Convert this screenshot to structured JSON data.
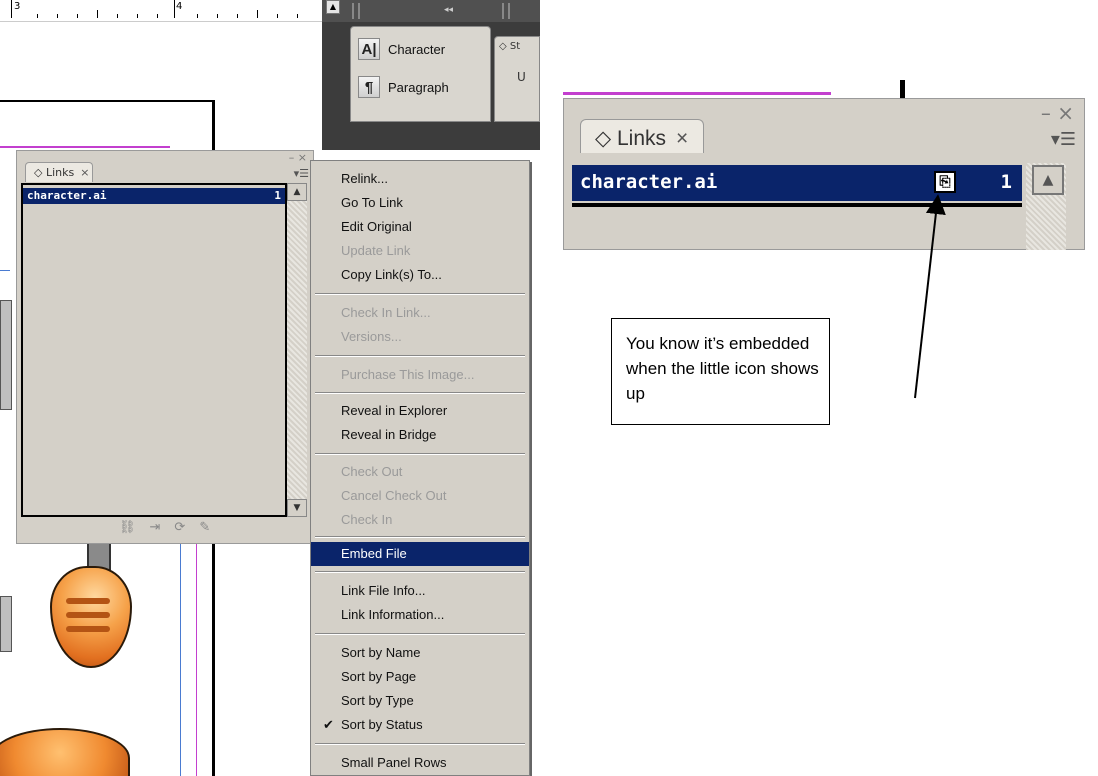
{
  "left_capture": {
    "ruler": {
      "mark_3": "3",
      "mark_4": "4"
    },
    "panel_dock": {
      "collapse_label": "◂◂",
      "items": [
        {
          "icon": "character-panel-icon",
          "glyph": "A|",
          "label": "Character"
        },
        {
          "icon": "paragraph-panel-icon",
          "glyph": "¶",
          "label": "Paragraph"
        }
      ],
      "partial_tab": "◇ St",
      "partial_tab_sub": "U"
    },
    "links_panel": {
      "tab_label": "◇ Links",
      "close_glyph": "×",
      "window_controls": "– ×",
      "menu_glyph": "▾☰",
      "rows": [
        {
          "name": "character.ai",
          "page": "1"
        }
      ]
    },
    "context_menu": {
      "items": [
        {
          "label": "Relink...",
          "disabled": false
        },
        {
          "label": "Go To Link",
          "disabled": false
        },
        {
          "label": "Edit Original",
          "disabled": false
        },
        {
          "label": "Update Link",
          "disabled": true
        },
        {
          "label": "Copy Link(s) To...",
          "disabled": false
        },
        {
          "label": "Check In Link...",
          "disabled": true
        },
        {
          "label": "Versions...",
          "disabled": true
        },
        {
          "label": "Purchase This Image...",
          "disabled": true
        },
        {
          "label": "Reveal in Explorer",
          "disabled": false
        },
        {
          "label": "Reveal in Bridge",
          "disabled": false
        },
        {
          "label": "Check Out",
          "disabled": true
        },
        {
          "label": "Cancel Check Out",
          "disabled": true
        },
        {
          "label": "Check In",
          "disabled": true
        },
        {
          "label": "Embed File",
          "disabled": false,
          "highlighted": true
        },
        {
          "label": "Link File Info...",
          "disabled": false
        },
        {
          "label": "Link Information...",
          "disabled": false
        },
        {
          "label": "Sort by Name",
          "disabled": false
        },
        {
          "label": "Sort by Page",
          "disabled": false
        },
        {
          "label": "Sort by Type",
          "disabled": false
        },
        {
          "label": "Sort by Status",
          "disabled": false,
          "checked": true
        },
        {
          "label": "Small Panel Rows",
          "disabled": false
        }
      ],
      "check_glyph": "✔"
    }
  },
  "right_capture": {
    "links_panel": {
      "tab_label": "◇ Links",
      "close_glyph": "×",
      "window_controls": "– ×",
      "menu_glyph": "▾☰",
      "row": {
        "name": "character.ai",
        "page": "1",
        "status_icon": "embedded-icon"
      }
    }
  },
  "callout": {
    "text": "You know it’s embedded when the little icon shows up"
  },
  "colors": {
    "selection": "#0a246a",
    "panel": "#d4d0c8",
    "dock": "#3c3c3c"
  }
}
